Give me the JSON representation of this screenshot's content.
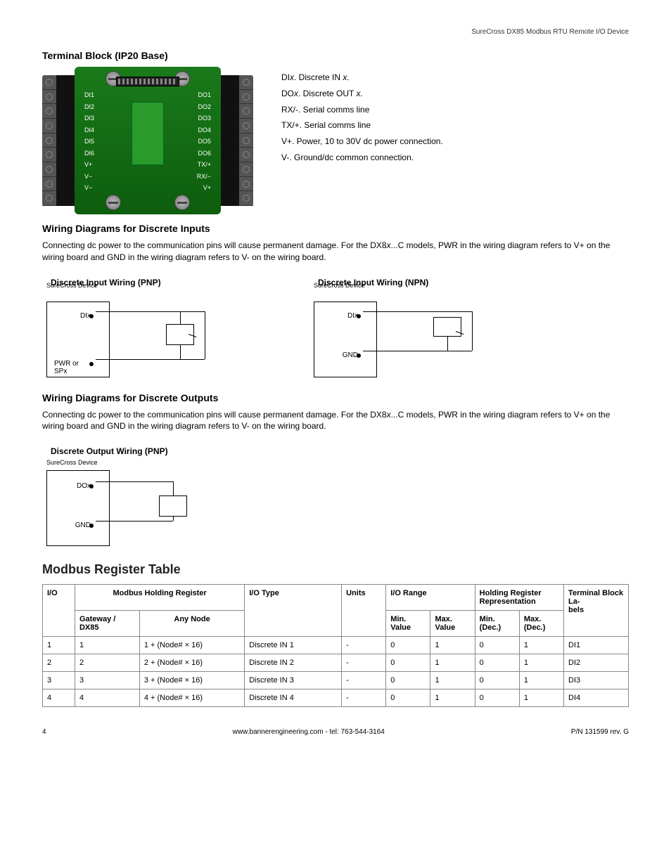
{
  "header": {
    "doc_title": "SureCross DX85 Modbus RTU Remote I/O Device"
  },
  "terminal_block": {
    "heading": "Terminal Block (IP20 Base)",
    "left_labels": [
      "DI1",
      "DI2",
      "DI3",
      "DI4",
      "DI5",
      "DI6",
      "V+",
      "V−",
      "V−"
    ],
    "right_labels": [
      "DO1",
      "DO2",
      "DO3",
      "DO4",
      "DO5",
      "DO6",
      "TX/+",
      "RX/−",
      "V+"
    ],
    "legend": [
      {
        "term": "DI",
        "suffix": "x",
        "sep": ". ",
        "desc": "Discrete IN ",
        "tail": "x."
      },
      {
        "term": "DO",
        "suffix": "x",
        "sep": ". ",
        "desc": "Discrete OUT ",
        "tail": "x."
      },
      {
        "term": "RX/-",
        "suffix": "",
        "sep": ". ",
        "desc": "Serial comms line",
        "tail": ""
      },
      {
        "term": "TX/+",
        "suffix": "",
        "sep": ". ",
        "desc": "Serial comms line",
        "tail": ""
      },
      {
        "term": "V+",
        "suffix": "",
        "sep": ". ",
        "desc": "Power, 10 to 30V dc power connection.",
        "tail": ""
      },
      {
        "term": "V-",
        "suffix": "",
        "sep": ". ",
        "desc": "Ground/dc common connection.",
        "tail": ""
      }
    ]
  },
  "inputs_section": {
    "heading": "Wiring Diagrams for Discrete Inputs",
    "body_a": "Connecting dc power to the communication pins will cause permanent damage. For the DX8",
    "body_b": "x",
    "body_c": "...C models, PWR in the wiring diagram refers to V+ on the wiring board and GND in the wiring diagram refers to V- on the wiring board.",
    "pnp": {
      "title": "Discrete Input Wiring (PNP)",
      "box_label": "SureCross Device",
      "line1": "DIx",
      "line2": "PWR or SPx"
    },
    "npn": {
      "title": "Discrete Input Wiring (NPN)",
      "box_label": "SureCross Device",
      "line1": "DIx",
      "line2": "GND"
    }
  },
  "outputs_section": {
    "heading": "Wiring Diagrams for Discrete Outputs",
    "body_a": "Connecting dc power to the communication pins will cause permanent damage. For the DX8",
    "body_b": "x",
    "body_c": "...C models, PWR in the wiring diagram refers to V+ on the wiring board and GND in the wiring diagram refers to V- on the wiring board.",
    "pnp": {
      "title": "Discrete Output Wiring (PNP)",
      "box_label": "SureCross Device",
      "line1": "DOx",
      "line2": "GND"
    }
  },
  "table_section": {
    "heading": "Modbus Register Table",
    "headers": {
      "io": "I/O",
      "mhr": "Modbus Holding Register",
      "iotype": "I/O Type",
      "units": "Units",
      "range": "I/O Range",
      "rep": "Holding Register Representation",
      "tbl": "Terminal Block La-",
      "tbl2": "bels",
      "gw": "Gateway / DX85",
      "any": "Any Node",
      "minv": "Min. Value",
      "maxv": "Max. Value",
      "mind": "Min. (Dec.)",
      "maxd": "Max. (Dec.)"
    },
    "rows": [
      {
        "io": "1",
        "gw": "1",
        "any": "1 + (Node# × 16)",
        "type": "Discrete IN 1",
        "units": "-",
        "minv": "0",
        "maxv": "1",
        "mind": "0",
        "maxd": "1",
        "lbl": "DI1"
      },
      {
        "io": "2",
        "gw": "2",
        "any": "2 + (Node# × 16)",
        "type": "Discrete IN 2",
        "units": "-",
        "minv": "0",
        "maxv": "1",
        "mind": "0",
        "maxd": "1",
        "lbl": "DI2"
      },
      {
        "io": "3",
        "gw": "3",
        "any": "3 + (Node# × 16)",
        "type": "Discrete IN 3",
        "units": "-",
        "minv": "0",
        "maxv": "1",
        "mind": "0",
        "maxd": "1",
        "lbl": "DI3"
      },
      {
        "io": "4",
        "gw": "4",
        "any": "4 + (Node# × 16)",
        "type": "Discrete IN 4",
        "units": "-",
        "minv": "0",
        "maxv": "1",
        "mind": "0",
        "maxd": "1",
        "lbl": "DI4"
      }
    ]
  },
  "footer": {
    "page": "4",
    "center": "www.bannerengineering.com - tel: 763-544-3164",
    "right": "P/N 131599 rev. G"
  }
}
